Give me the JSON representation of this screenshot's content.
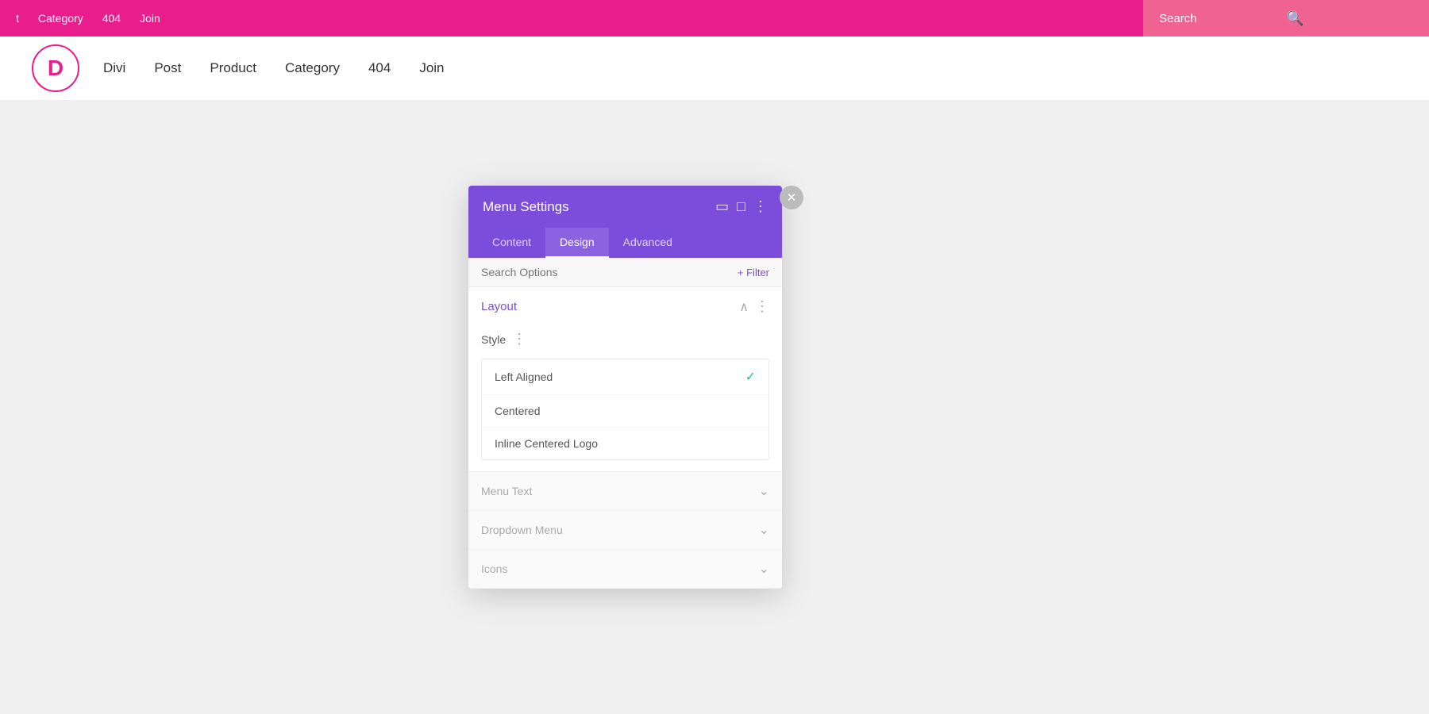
{
  "topbar": {
    "nav_items": [
      "t",
      "Category",
      "404",
      "Join"
    ],
    "search_placeholder": "Search"
  },
  "header": {
    "logo_letter": "D",
    "nav_items": [
      "Divi",
      "Post",
      "Product",
      "Category",
      "404",
      "Join"
    ]
  },
  "modal": {
    "title": "Menu Settings",
    "tabs": [
      "Content",
      "Design",
      "Advanced"
    ],
    "active_tab": "Design",
    "search_options_placeholder": "Search Options",
    "filter_label": "+ Filter",
    "layout_section": {
      "title": "Layout",
      "style_label": "Style",
      "dropdown_options": [
        {
          "label": "Left Aligned",
          "selected": true
        },
        {
          "label": "Centered",
          "selected": false
        },
        {
          "label": "Inline Centered Logo",
          "selected": false
        }
      ]
    },
    "collapsed_sections": [
      {
        "title": "Menu Text"
      },
      {
        "title": "Dropdown Menu"
      },
      {
        "title": "Icons"
      }
    ]
  },
  "icons": {
    "check": "✓",
    "chevron_up": "∧",
    "chevron_down": "∨",
    "more_vert": "⋮",
    "close": "×",
    "fullscreen": "⛶",
    "split": "⊞",
    "search_sym": "🔍"
  }
}
